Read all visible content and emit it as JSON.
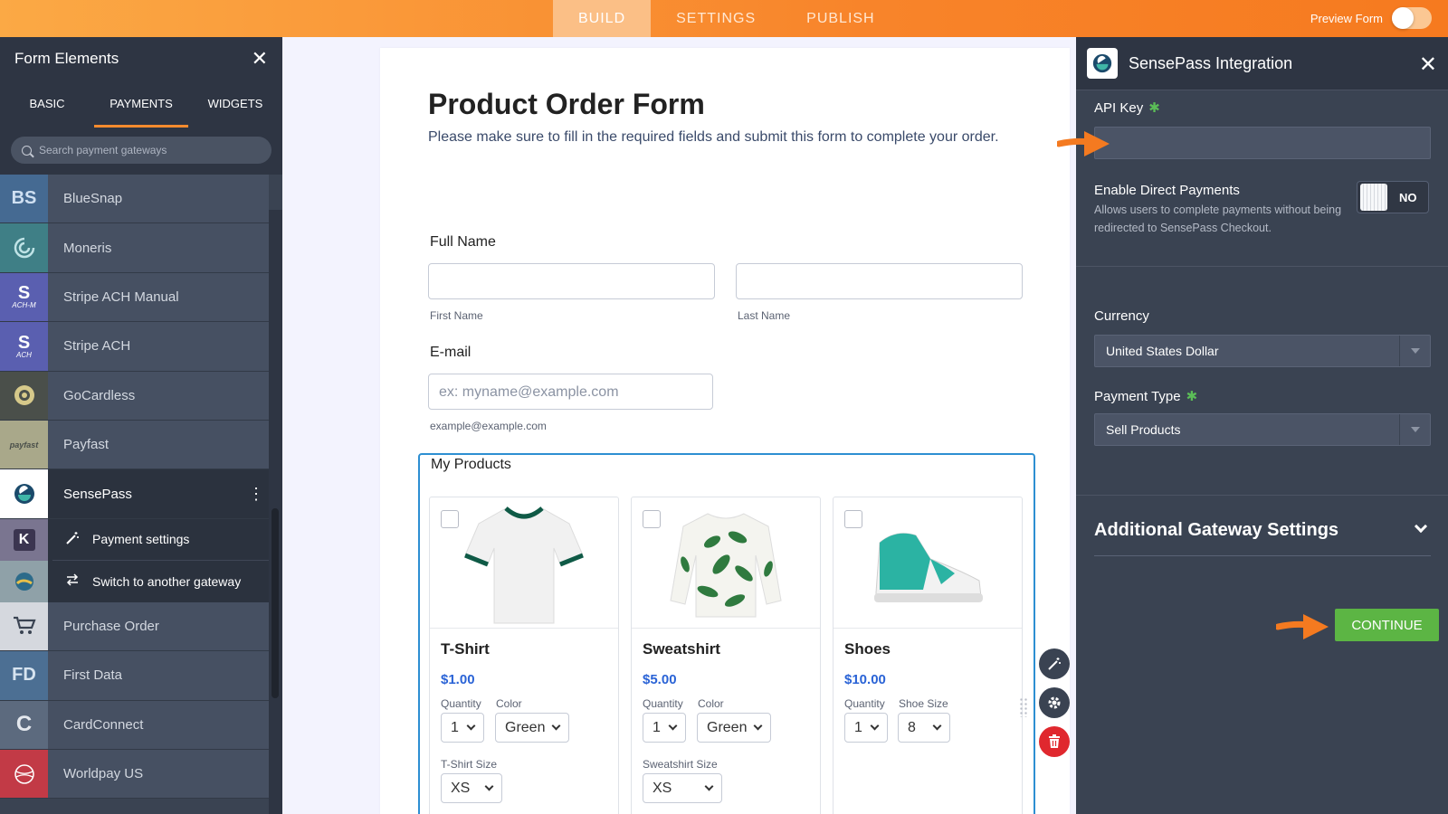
{
  "topbar": {
    "tabs": [
      "BUILD",
      "SETTINGS",
      "PUBLISH"
    ],
    "preview_label": "Preview Form"
  },
  "left_panel": {
    "title": "Form Elements",
    "tabs": [
      "BASIC",
      "PAYMENTS",
      "WIDGETS"
    ],
    "search_placeholder": "Search payment gateways",
    "gateways": [
      {
        "name": "BlueSnap",
        "logo": "BS"
      },
      {
        "name": "Moneris",
        "logo": "moneris-icon"
      },
      {
        "name": "Stripe ACH Manual",
        "logo": "S"
      },
      {
        "name": "Stripe ACH",
        "logo": "S"
      },
      {
        "name": "GoCardless",
        "logo": "gocardless-icon"
      },
      {
        "name": "Payfast",
        "logo": "payfast"
      },
      {
        "name": "SensePass",
        "logo": "sensepass-icon"
      }
    ],
    "stripe_sub": [
      "ACH-M",
      "ACH"
    ],
    "submenu": [
      "Payment settings",
      "Switch to another gateway"
    ],
    "gateways_after": [
      {
        "name": "Purchase Order",
        "logo": "cart-icon"
      },
      {
        "name": "First Data",
        "logo": "FD"
      },
      {
        "name": "CardConnect",
        "logo": "C"
      },
      {
        "name": "Worldpay US",
        "logo": "worldpay-icon"
      }
    ],
    "hidden_logos": [
      "K",
      "globe-icon"
    ]
  },
  "form": {
    "title": "Product Order Form",
    "description": "Please make sure to fill in the required fields and submit this form to complete your order.",
    "full_name_label": "Full Name",
    "first_name_sub": "First Name",
    "last_name_sub": "Last Name",
    "email_label": "E-mail",
    "email_placeholder": "ex: myname@example.com",
    "email_sub": "example@example.com",
    "products_label": "My Products",
    "products": [
      {
        "name": "T-Shirt",
        "price": "$1.00",
        "opt1_label": "Quantity",
        "opt1": "1",
        "opt2_label": "Color",
        "opt2": "Green",
        "opt3_label": "T-Shirt Size",
        "opt3": "XS"
      },
      {
        "name": "Sweatshirt",
        "price": "$5.00",
        "opt1_label": "Quantity",
        "opt1": "1",
        "opt2_label": "Color",
        "opt2": "Green",
        "opt3_label": "Sweatshirt Size",
        "opt3": "XS"
      },
      {
        "name": "Shoes",
        "price": "$10.00",
        "opt1_label": "Quantity",
        "opt1": "1",
        "opt2_label": "Shoe Size",
        "opt2": "8"
      }
    ]
  },
  "right_panel": {
    "title": "SensePass Integration",
    "api_key_label": "API Key",
    "direct_label": "Enable Direct Payments",
    "direct_desc": "Allows users to complete payments without being redirected to SensePass Checkout.",
    "direct_toggle": "NO",
    "currency_label": "Currency",
    "currency_value": "United States Dollar",
    "payment_type_label": "Payment Type",
    "payment_type_value": "Sell Products",
    "additional_label": "Additional Gateway Settings",
    "continue_label": "CONTINUE"
  },
  "colors": {
    "accent_orange": "#f8842a",
    "continue_green": "#5cb544",
    "price_blue": "#2a63d6",
    "required_star": "#5bbd57"
  }
}
